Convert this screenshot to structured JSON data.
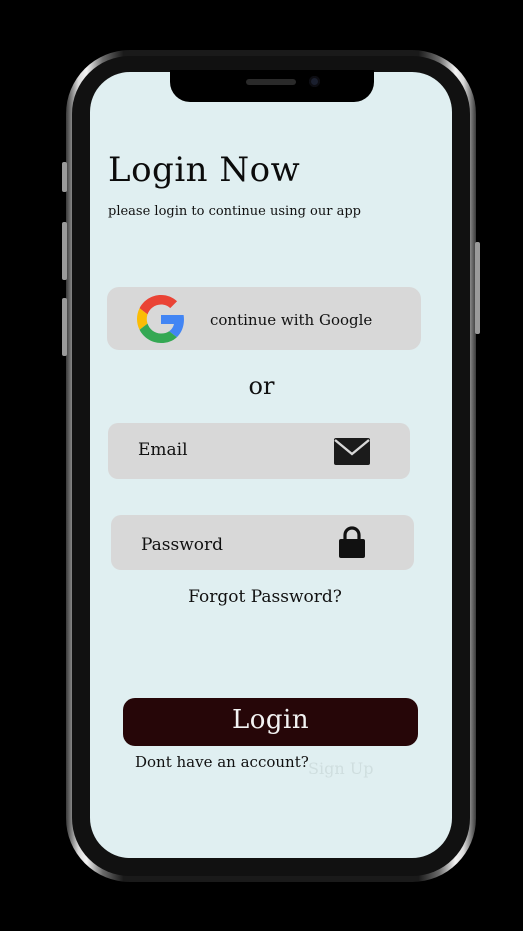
{
  "header": {
    "title": "Login Now",
    "subtitle": "please login to continue using our app"
  },
  "google_button": {
    "label": "continue with Google",
    "icon": "google-logo-icon"
  },
  "divider": {
    "text": "or"
  },
  "email_field": {
    "label": "Email",
    "icon": "mail-icon"
  },
  "password_field": {
    "label": "Password",
    "icon": "lock-icon"
  },
  "forgot_password": {
    "label": "Forgot Password?"
  },
  "login_button": {
    "label": "Login"
  },
  "signup_prompt": {
    "text": "Dont have an account?",
    "link": "Sign Up"
  },
  "colors": {
    "screen_background": "#e0eff1",
    "field_background": "#d8d8d8",
    "login_button": "#260608",
    "signup_link": "#cfdedf"
  }
}
